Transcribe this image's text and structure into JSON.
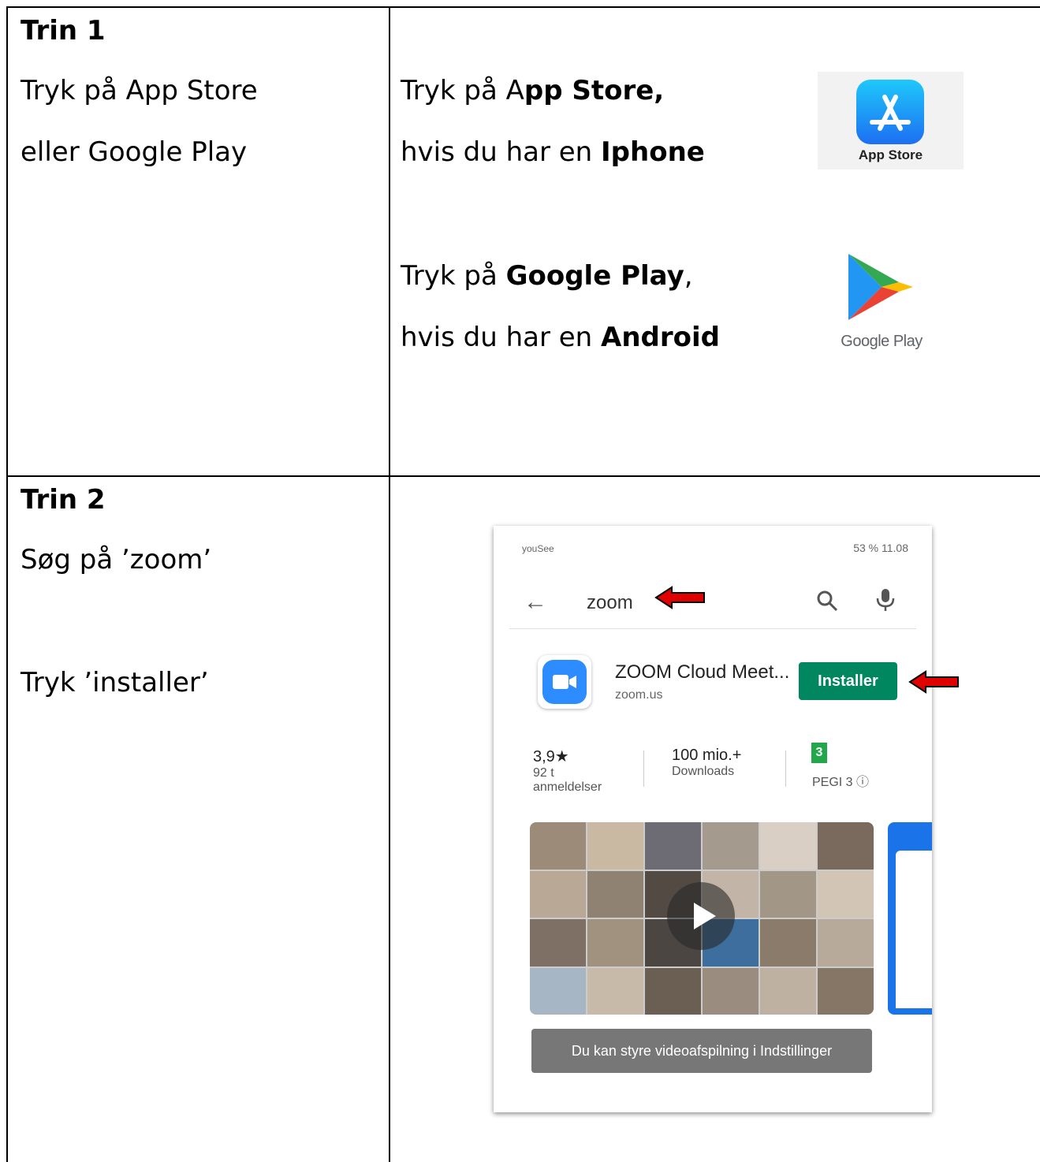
{
  "step1": {
    "title": "Trin 1",
    "line1": "Tryk på App Store",
    "line2": "eller Google Play",
    "ios_pre": "Tryk på A",
    "ios_bold": "pp Store,",
    "ios_line2_pre": "hvis du har en ",
    "ios_line2_bold": "Iphone",
    "android_pre": "Tryk på ",
    "android_bold": "Google Play",
    "android_post": ",",
    "android_line2_pre": "hvis du har en ",
    "android_line2_bold": "Android",
    "appstore_label": "App Store",
    "googleplay_label": "Google Play"
  },
  "step2": {
    "title": "Trin 2",
    "line1": "Søg på ’zoom’",
    "line2": "Tryk ’installer’"
  },
  "phone": {
    "status_left": "youSee",
    "status_right": "53 %  11.08",
    "search_query": "zoom",
    "app_name": "ZOOM Cloud Meet...",
    "app_developer": "zoom.us",
    "install_label": "Installer",
    "rating_value": "3,9★",
    "rating_count": "92 t",
    "rating_label": "anmeldelser",
    "downloads_value": "100 mio.+",
    "downloads_label": "Downloads",
    "pegi_number": "3",
    "pegi_label": "PEGI 3 ⓘ",
    "toast": "Du kan styre videoafspilning i Indstillinger"
  }
}
